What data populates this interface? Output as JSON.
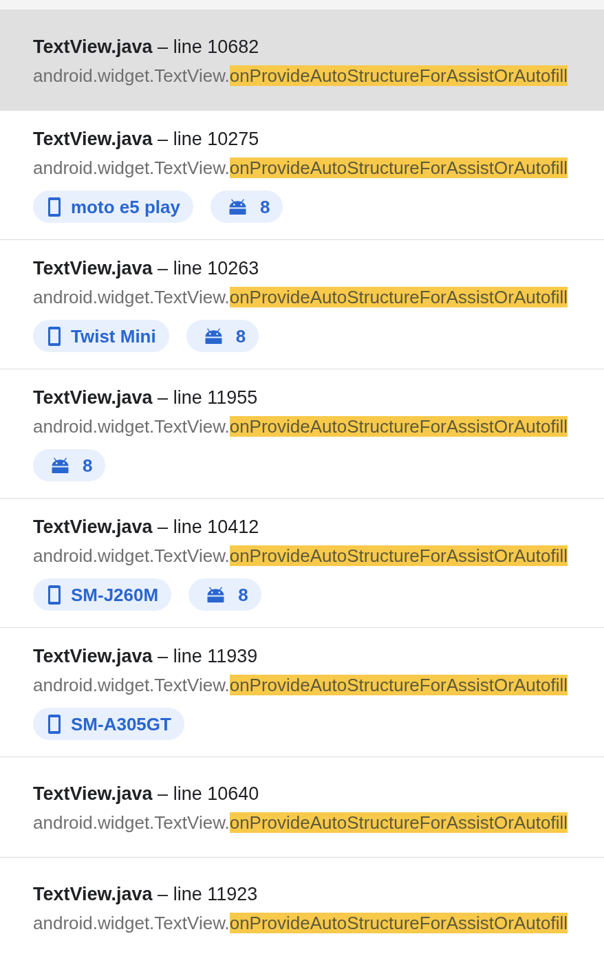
{
  "results": [
    {
      "title": "**TextView.java** – line 10682",
      "symbol_prefix": "android.widget.TextView.",
      "symbol_match": "onProvideAutoStructureForAssistOrAutofill",
      "selected": true
    },
    {
      "title": "**TextView.java** – line 10275",
      "symbol_prefix": "android.widget.TextView.",
      "symbol_match": "onProvideAutoStructureForAssistOrAutofill",
      "selected": false,
      "chips": [
        {
          "kind": "device",
          "label": "moto e5 play"
        },
        {
          "kind": "os",
          "label": "8"
        }
      ]
    },
    {
      "title": "**TextView.java** – line 10263",
      "symbol_prefix": "android.widget.TextView.",
      "symbol_match": "onProvideAutoStructureForAssistOrAutofill",
      "selected": false,
      "chips": [
        {
          "kind": "device",
          "label": "Twist Mini"
        },
        {
          "kind": "os",
          "label": "8"
        }
      ]
    },
    {
      "title": "**TextView.java** – line 11955",
      "symbol_prefix": "android.widget.TextView.",
      "symbol_match": "onProvideAutoStructureForAssistOrAutofill",
      "selected": false,
      "chips": [
        {
          "kind": "os",
          "label": "8"
        }
      ]
    },
    {
      "title": "**TextView.java** – line 10412",
      "symbol_prefix": "android.widget.TextView.",
      "symbol_match": "onProvideAutoStructureForAssistOrAutofill",
      "selected": false,
      "chips": [
        {
          "kind": "device",
          "label": "SM-J260M"
        },
        {
          "kind": "os",
          "label": "8"
        }
      ]
    },
    {
      "title": "**TextView.java** – line 11939",
      "symbol_prefix": "android.widget.TextView.",
      "symbol_match": "onProvideAutoStructureForAssistOrAutofill",
      "selected": false,
      "chips": [
        {
          "kind": "device",
          "label": "SM-A305GT"
        }
      ]
    },
    {
      "title": "**TextView.java** – line 10640",
      "symbol_prefix": "android.widget.TextView.",
      "symbol_match": "onProvideAutoStructureForAssistOrAutofill",
      "selected": false
    },
    {
      "title": "**TextView.java** – line 11923",
      "symbol_prefix": "android.widget.TextView.",
      "symbol_match": "onProvideAutoStructureForAssistOrAutofill",
      "selected": false
    }
  ]
}
